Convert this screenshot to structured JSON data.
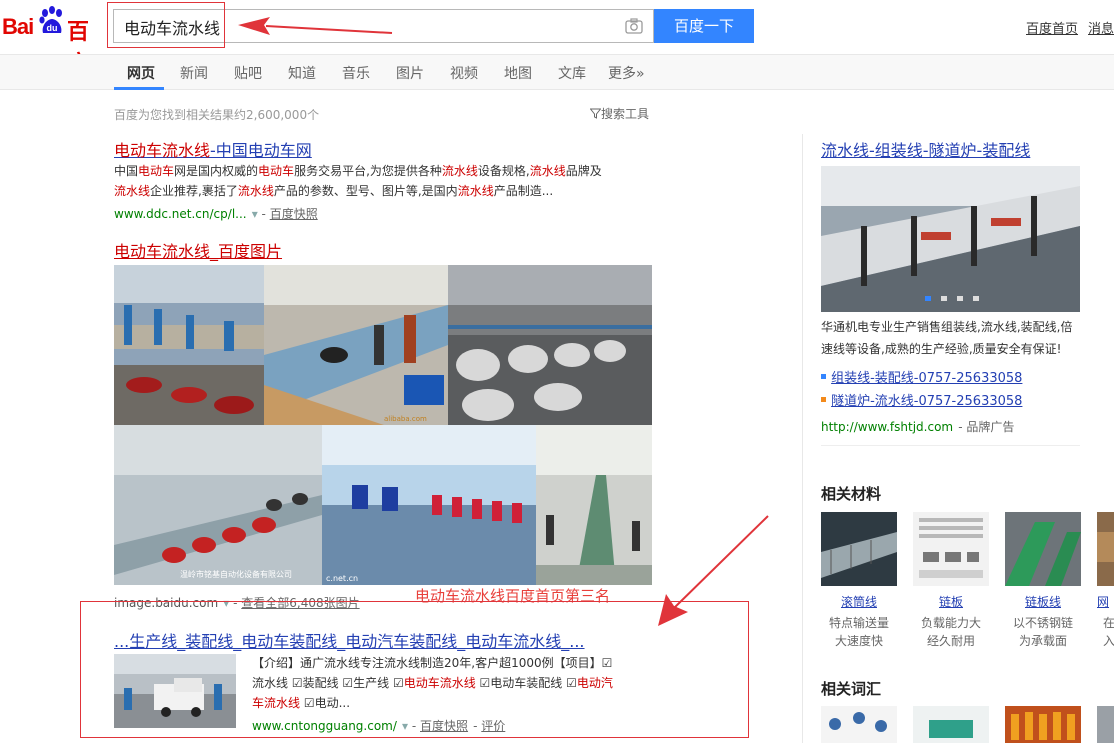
{
  "header": {
    "logo_text_1": "Bai",
    "logo_text_du": "du",
    "logo_text_2": "百度",
    "search_value": "电动车流水线",
    "search_button": "百度一下",
    "links": [
      "百度首页",
      "消息"
    ]
  },
  "nav": {
    "tabs": [
      "网页",
      "新闻",
      "贴吧",
      "知道",
      "音乐",
      "图片",
      "视频",
      "地图",
      "文库",
      "更多»"
    ],
    "active": "网页"
  },
  "results_meta": {
    "count_text": "百度为您找到相关结果约2,600,000个",
    "tools": "搜索工具"
  },
  "result1": {
    "title_em": "电动车流水线",
    "title_rest": "-中国电动车网",
    "abstract_line1": [
      {
        "t": "中国",
        "em": false
      },
      {
        "t": "电动车",
        "em": true
      },
      {
        "t": "网是国内权威的",
        "em": false
      },
      {
        "t": "电动车",
        "em": true
      },
      {
        "t": "服务交易平台,为您提供各种",
        "em": false
      },
      {
        "t": "流水线",
        "em": true
      },
      {
        "t": "设备规格,",
        "em": false
      },
      {
        "t": "流水线",
        "em": true
      },
      {
        "t": "品牌及",
        "em": false
      }
    ],
    "abstract_line2": [
      {
        "t": "流水线",
        "em": true
      },
      {
        "t": "企业推荐,裹括了",
        "em": false
      },
      {
        "t": "流水线",
        "em": true
      },
      {
        "t": "产品的参数、型号、图片等,是国内",
        "em": false
      },
      {
        "t": "流水线",
        "em": true
      },
      {
        "t": "产品制造...",
        "em": false
      }
    ],
    "url": "www.ddc.net.cn/cp/l...",
    "snapshot": "百度快照"
  },
  "result2": {
    "title": "电动车流水线_百度图片",
    "image_watermarks": [
      "alibaba.com",
      "温岭市铭基自动化设备有限公司",
      "c.net.cn"
    ],
    "url": "image.baidu.com",
    "more_link": "查看全部6,408张图片"
  },
  "annotation": {
    "text": "电动车流水线百度首页第三名"
  },
  "result3": {
    "title": "...生产线_装配线_电动车装配线_电动汽车装配线_电动车流水线_...",
    "abstract_line1": "【介绍】通广流水线专注流水线制造20年,客户超1000例【项目】☑",
    "abstract_line2": [
      {
        "t": "流水线 ☑装配线 ☑生产线 ☑",
        "em": false
      },
      {
        "t": "电动车流水线",
        "em": true
      },
      {
        "t": " ☑电动车装配线 ☑",
        "em": false
      },
      {
        "t": "电动汽",
        "em": true
      }
    ],
    "abstract_line3": [
      {
        "t": "车流水线",
        "em": true
      },
      {
        "t": " ☑电动...",
        "em": false
      }
    ],
    "url": "www.cntongguang.com/",
    "snapshot": "百度快照",
    "review": "评价"
  },
  "right_ad": {
    "title": "流水线-组装线-隧道炉-装配线",
    "desc": "华通机电专业生产销售组装线,流水线,装配线,倍速线等设备,成熟的生产经验,质量安全有保证!",
    "links": [
      "组装线-装配线-0757-25633058",
      "隧道炉-流水线-0757-25633058"
    ],
    "url": "http://www.fshtjd.com",
    "brand": "品牌广告"
  },
  "related_materials": {
    "title": "相关材料",
    "items": [
      {
        "label": "滚筒线",
        "desc1": "特点输送量",
        "desc2": "大速度快"
      },
      {
        "label": "链板",
        "desc1": "负载能力大",
        "desc2": "经久耐用"
      },
      {
        "label": "链板线",
        "desc1": "以不锈钢链",
        "desc2": "为承载面"
      },
      {
        "label": "网",
        "desc1": "在",
        "desc2": "入"
      }
    ]
  },
  "related_terms": {
    "title": "相关词汇"
  },
  "colors": {
    "accent": "#3385ff",
    "link": "#2440b3",
    "highlight": "#c00000",
    "url_green": "#008000",
    "annotation_red": "#e0343a"
  }
}
